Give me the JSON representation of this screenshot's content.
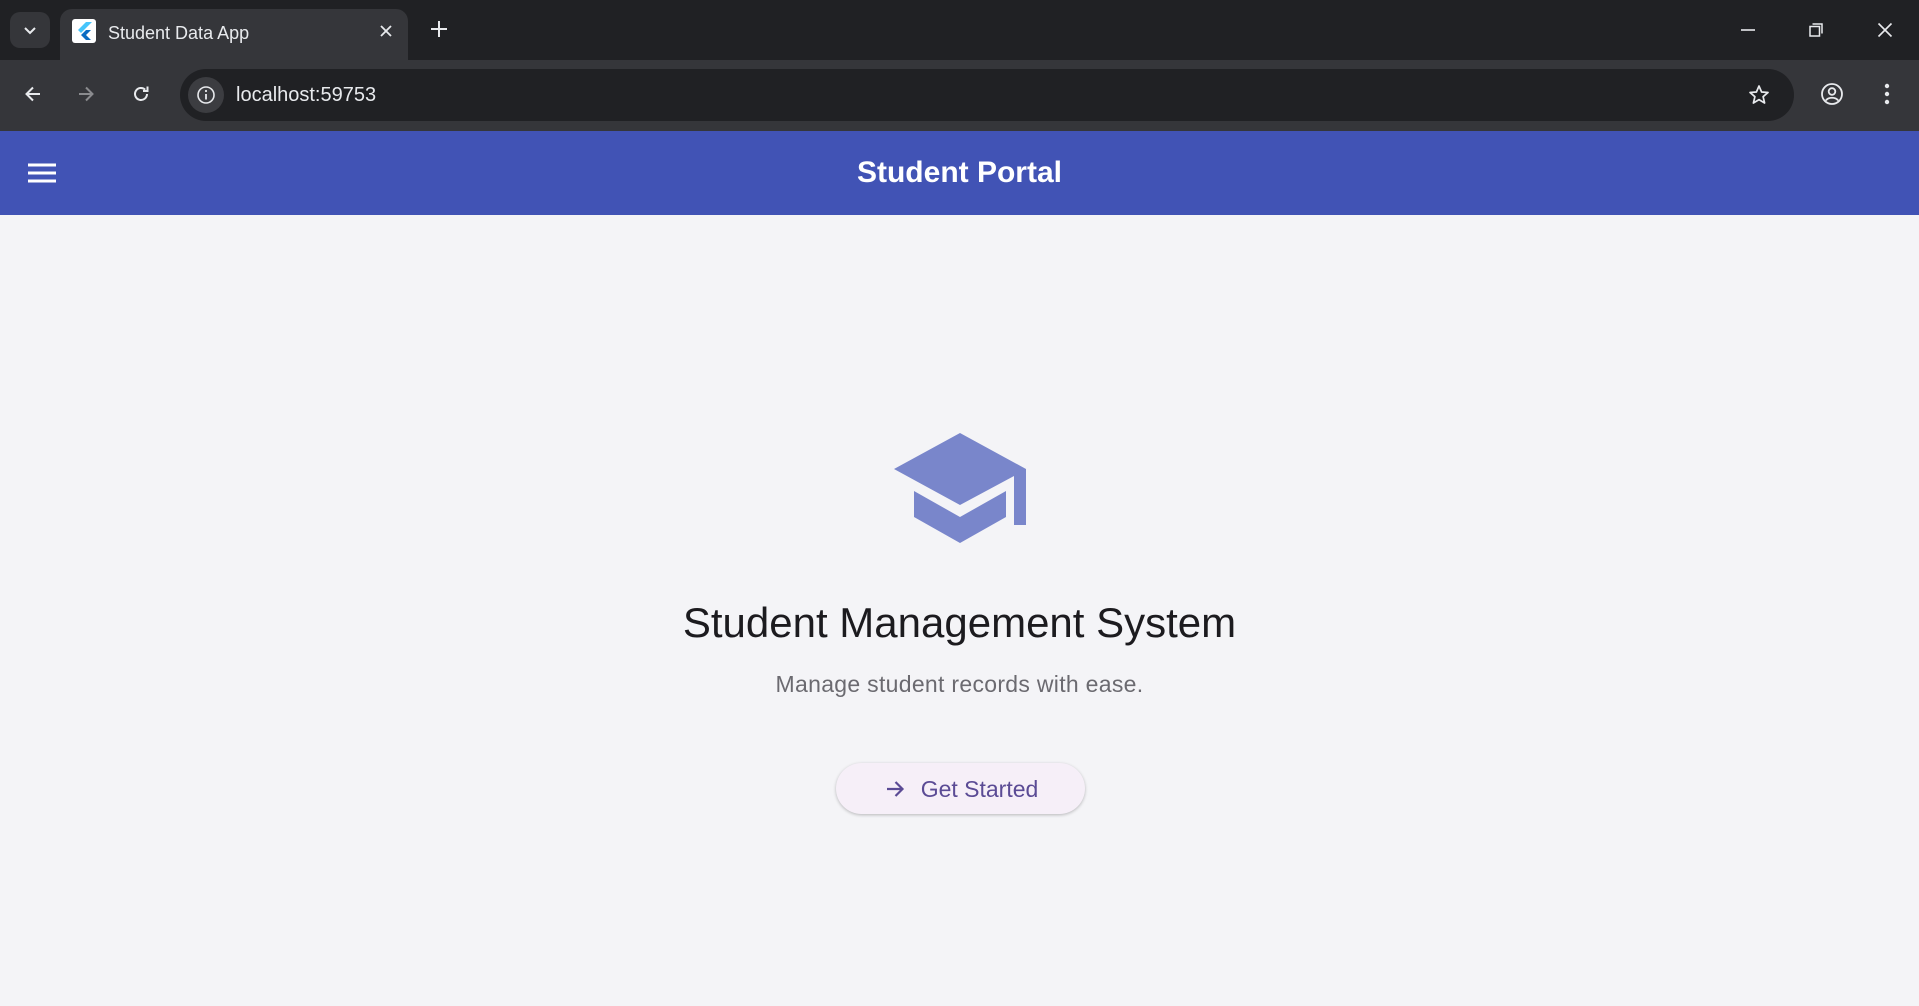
{
  "browser": {
    "tab_title": "Student Data App",
    "url": "localhost:59753",
    "icons": {
      "tab_search": "chevron-down-icon",
      "tab_close": "close-icon",
      "new_tab": "plus-icon",
      "minimize": "minimize-icon",
      "restore": "restore-icon",
      "close_window": "close-icon",
      "back": "arrow-left-icon",
      "forward": "arrow-right-icon",
      "reload": "reload-icon",
      "site_info": "info-icon",
      "bookmark": "star-icon",
      "profile": "account-icon",
      "menu": "more-vert-icon"
    }
  },
  "app": {
    "header": {
      "title": "Student Portal",
      "menu_icon": "hamburger-menu-icon",
      "color": "#4153b5"
    },
    "hero": {
      "icon": "graduation-cap-icon",
      "icon_color": "#7986cb",
      "title": "Student Management System",
      "subtitle": "Manage student records with ease.",
      "button_label": "Get Started",
      "button_icon": "arrow-right-icon",
      "button_text_color": "#5b4b95"
    }
  }
}
